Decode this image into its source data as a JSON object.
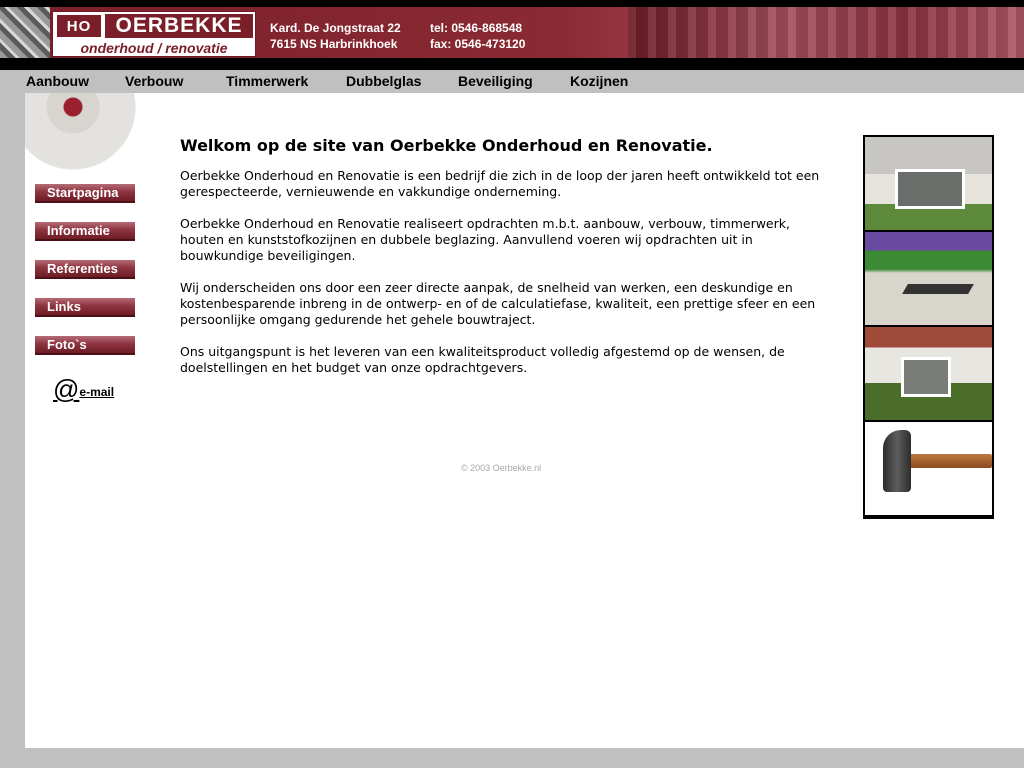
{
  "header": {
    "logo_mark": "HO",
    "logo_name": "OERBEKKE",
    "logo_tagline": "onderhoud / renovatie",
    "address_line1": "Kard. De Jongstraat 22",
    "address_line2": "7615 NS Harbrinkhoek",
    "tel": "tel:  0546-868548",
    "fax": "fax: 0546-473120"
  },
  "topnav": {
    "items": [
      {
        "label": "Aanbouw"
      },
      {
        "label": "Verbouw"
      },
      {
        "label": "Timmerwerk"
      },
      {
        "label": "Dubbelglas"
      },
      {
        "label": "Beveiliging"
      },
      {
        "label": "Kozijnen"
      }
    ]
  },
  "sidebar": {
    "buttons": [
      {
        "label": "Startpagina"
      },
      {
        "label": "Informatie"
      },
      {
        "label": "Referenties"
      },
      {
        "label": "Links"
      },
      {
        "label": "Foto`s"
      }
    ],
    "email_symbol": "@",
    "email_label": "e-mail"
  },
  "content": {
    "title": "Welkom op de site van Oerbekke Onderhoud en Renovatie.",
    "paragraphs": [
      "Oerbekke Onderhoud en Renovatie is een bedrijf die zich in de loop der jaren heeft ontwikkeld tot een gerespecteerde, vernieuwende en vakkundige onderneming.",
      "Oerbekke Onderhoud en Renovatie realiseert opdrachten m.b.t. aanbouw, verbouw, timmerwerk, houten en kunststofkozijnen en dubbele beglazing.  Aanvullend voeren wij opdrachten uit in bouwkundige beveiligingen.",
      "Wij onderscheiden ons door een zeer directe aanpak, de snelheid van werken, een deskundige en kostenbesparende inbreng in de ontwerp- en of de calculatiefase, kwaliteit, een prettige sfeer en een persoonlijke omgang gedurende het gehele bouwtraject.",
      "Ons uitgangspunt is het leveren van een kwaliteitsproduct volledig afgestemd op de wensen, de doelstellingen en het budget van onze opdrachtgevers."
    ]
  },
  "footer": {
    "copyright": "© 2003 Oerbekke.nl"
  },
  "colors": {
    "brand": "#7a1f29",
    "background": "#c0c0c0"
  }
}
